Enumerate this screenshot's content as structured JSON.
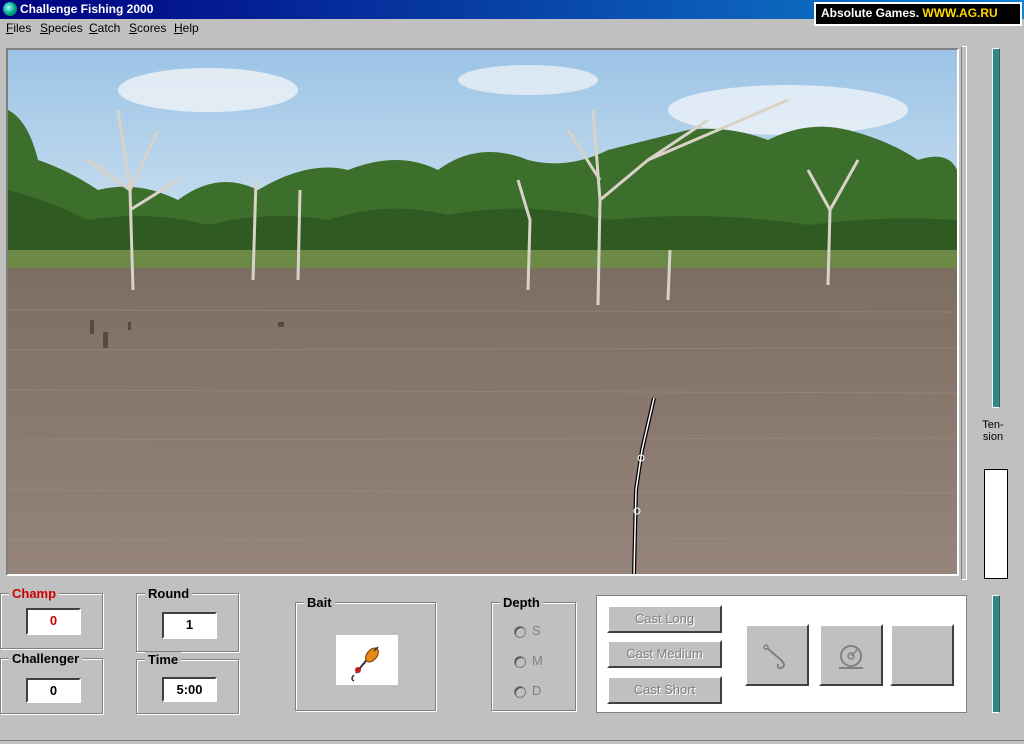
{
  "window": {
    "title": "Challenge Fishing 2000"
  },
  "banner": {
    "brand": "Absolute Games.",
    "url": "WWW.AG.RU"
  },
  "menu": [
    {
      "key": "F",
      "rest": "iles"
    },
    {
      "key": "S",
      "rest": "pecies"
    },
    {
      "key": "C",
      "rest": "atch"
    },
    {
      "key": "S",
      "rest": "cores"
    },
    {
      "key": "H",
      "rest": "elp"
    }
  ],
  "scores": {
    "champ": {
      "label": "Champ",
      "value": "0",
      "color": "#cc0000"
    },
    "challenger": {
      "label": "Challenger",
      "value": "0"
    },
    "round": {
      "label": "Round",
      "value": "1"
    },
    "time": {
      "label": "Time",
      "value": "5:00"
    }
  },
  "bait": {
    "label": "Bait",
    "icon": "spinner-lure-icon"
  },
  "depth": {
    "label": "Depth",
    "options": [
      "S",
      "M",
      "D"
    ]
  },
  "cast": {
    "long": "Cast Long",
    "medium": "Cast Medium",
    "short": "Cast Short"
  },
  "actions": [
    {
      "icon": "hook-icon"
    },
    {
      "icon": "reel-icon"
    },
    {
      "icon": "blank"
    }
  ],
  "tension": {
    "label_line1": "Ten-",
    "label_line2": "sion"
  },
  "colors": {
    "accent": "#2a8a8a",
    "titlebar": "#000080",
    "water": "#8a7a6c"
  }
}
